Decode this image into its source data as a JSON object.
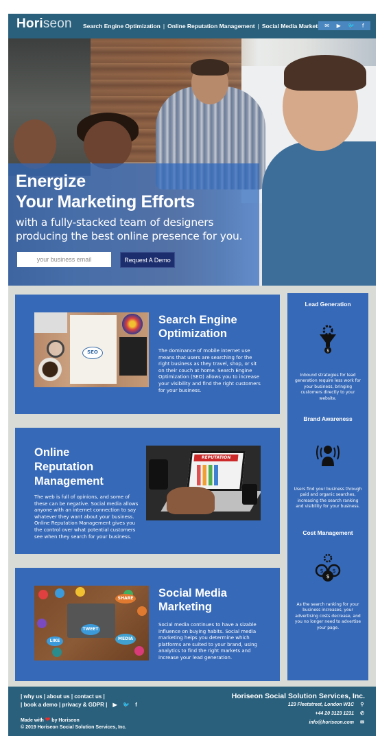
{
  "header": {
    "logo_first": "Hori",
    "logo_rest": "seon",
    "nav": [
      {
        "label": "Search Engine Optimization"
      },
      {
        "label": "Online Reputation Management"
      },
      {
        "label": "Social Media Marketing"
      }
    ],
    "nav_separator": "|",
    "social_icons": [
      "email-icon",
      "youtube-icon",
      "twitter-icon",
      "facebook-icon"
    ]
  },
  "hero": {
    "title_line1": "Energize",
    "title_line2": "Your Marketing Efforts",
    "subtitle_line1": "with a fully-stacked team of designers",
    "subtitle_line2": "producing the best online presence for you.",
    "email_placeholder": "your business email",
    "button_label": "Request A Demo"
  },
  "sections": {
    "seo": {
      "title_line1": "Search Engine",
      "title_line2": "Optimization",
      "body": "The dominance of mobile internet use means that users are searching for the right business as they travel, shop, or sit on their couch at home. Search Engine Optimization (SEO) allows you to increase your visibility and find the right customers for your business.",
      "image_text": "SEO"
    },
    "orm": {
      "title_line1": "Online",
      "title_line2": "Reputation",
      "title_line3": "Management",
      "body": "The web is full of opinions, and some of these can be negative. Social media allows anyone with an internet connection to say whatever they want about your business. Online Reputation Management gives you the control over what potential customers see when they search for your business.",
      "image_text": "REPUTATION"
    },
    "smm": {
      "title_line1": "Social Media",
      "title_line2": "Marketing",
      "body": "Social media continues to have a sizable influence on buying habits. Social media marketing helps you determine which platforms are suited to your brand, using analytics to find the right markets and increase your lead generation.",
      "image_words": [
        "SHARE",
        "TWEET",
        "LIKE",
        "MEDIA"
      ]
    }
  },
  "sidebar": {
    "lead": {
      "title": "Lead Generation",
      "body": "Inbound strategies for lead generation require less work for your business, bringing customers directly to your website.",
      "icon": "lead-funnel-icon"
    },
    "brand": {
      "title": "Brand Awareness",
      "body": "Users find your business through paid and organic searches, increasing the search ranking and visibility for your business.",
      "icon": "brand-awareness-icon"
    },
    "cost": {
      "title": "Cost Management",
      "body": "As the search ranking for your business increases, your advertising costs decrease, and you no longer need to advertise your page.",
      "icon": "cost-coins-icon"
    }
  },
  "footer": {
    "links_row1": [
      "why us",
      "about us",
      "contact us"
    ],
    "links_row2": [
      "book a demo",
      "privacy & GDPR"
    ],
    "made_with_prefix": "Made with",
    "made_with_suffix": "by Horiseon",
    "copyright": "© 2019 Horiseon Social Solution Services, Inc.",
    "company": "Horiseon Social Solution Services, Inc.",
    "address": "123 Fleetstreet, London W1C",
    "phone": "+44 20 3123 1231",
    "email": "info@horiseon.com"
  },
  "colors": {
    "header_bg": "#2a607c",
    "card_bg": "#3669b8",
    "page_bg": "#d9dcd6",
    "button_bg": "#1c2e6e"
  }
}
